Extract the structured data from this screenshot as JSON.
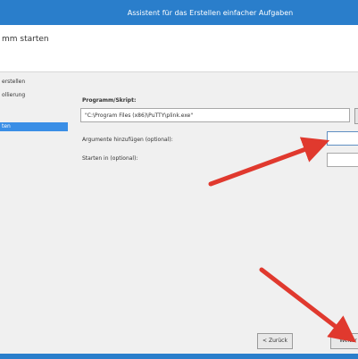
{
  "window": {
    "title": "Assistent für das Erstellen einfacher Aufgaben"
  },
  "header": {
    "title": "mm starten"
  },
  "sidebar": {
    "items": [
      {
        "label": "erstellen"
      },
      {
        "label": "ollierung"
      },
      {
        "label": "ten"
      }
    ]
  },
  "form": {
    "program_label": "Programm/Skript:",
    "program_value": "\"C:\\Program Files (x86)\\PuTTY\\plink.exe\"",
    "arguments_label": "Argumente hinzufügen (optional):",
    "arguments_value": "",
    "startin_label": "Starten in (optional):",
    "startin_value": ""
  },
  "buttons": {
    "back_label": "< Zurück",
    "next_label": "Weiter"
  },
  "colors": {
    "titlebar": "#2a7ecb",
    "selected": "#3a8ee6",
    "arrow": "#e0392e"
  }
}
